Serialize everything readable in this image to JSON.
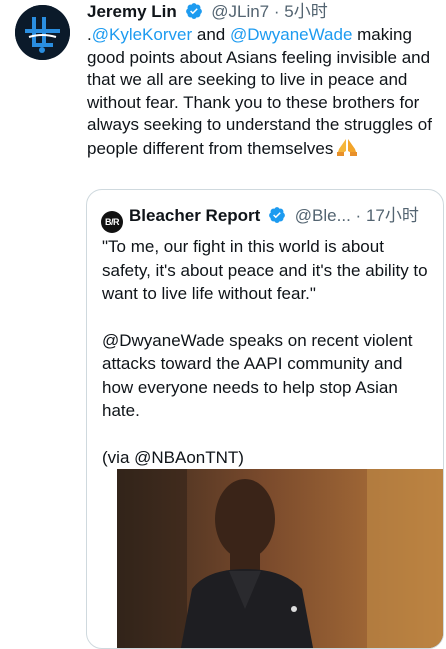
{
  "tweet": {
    "author_name": "Jeremy Lin",
    "author_handle": "@JLin7",
    "separator": "·",
    "time": "5小时",
    "text_parts": [
      ".",
      "@KyleKorver",
      " and ",
      "@DwyaneWade",
      "  making good points about Asians feeling invisible and that we all are seeking to live in peace and without fear. Thank you to these brothers for always seeking to understand the struggles of people different from themselves"
    ],
    "emoji": "🙏"
  },
  "quoted": {
    "logo_text": "B/R",
    "author_name": "Bleacher Report",
    "author_handle": "@Ble...",
    "separator": "·",
    "time": "17小时",
    "paragraphs": [
      "\"To me, our fight in this world is about safety, it's about peace and it's the ability to want to live life without fear.\"",
      "@DwyaneWade speaks on recent violent attacks toward the AAPI community and how everyone needs to help stop Asian hate.",
      "(via @NBAonTNT)"
    ]
  },
  "colors": {
    "link": "#1d9bf0",
    "verified": "#1d9bf0",
    "muted": "#536471",
    "border": "#cfd9de"
  },
  "icons": {
    "verified": "verified-badge-icon"
  }
}
